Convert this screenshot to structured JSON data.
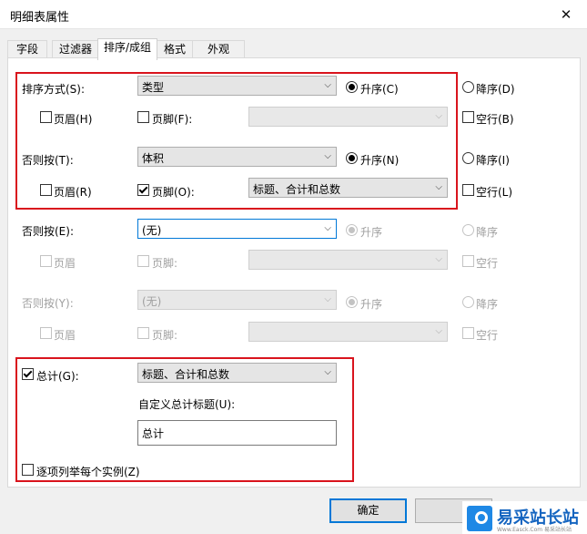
{
  "window": {
    "title": "明细表属性"
  },
  "tabs": [
    "字段",
    "过滤器",
    "排序/成组",
    "格式",
    "外观"
  ],
  "rows": [
    {
      "label": "排序方式(S):",
      "combo": "类型",
      "asc": "升序(C)",
      "desc": "降序(D)",
      "header": "页眉(H)",
      "footer": "页脚(F):",
      "footer_combo": "",
      "blank": "空行(B)"
    },
    {
      "label": "否则按(T):",
      "combo": "体积",
      "asc": "升序(N)",
      "desc": "降序(I)",
      "header": "页眉(R)",
      "footer": "页脚(O):",
      "footer_combo": "标题、合计和总数",
      "blank": "空行(L)"
    },
    {
      "label": "否则按(E):",
      "combo": "(无)",
      "asc": "升序",
      "desc": "降序",
      "header": "页眉",
      "footer": "页脚:",
      "footer_combo": "",
      "blank": "空行"
    },
    {
      "label": "否则按(Y):",
      "combo": "(无)",
      "asc": "升序",
      "desc": "降序",
      "header": "页眉",
      "footer": "页脚:",
      "footer_combo": "",
      "blank": "空行"
    }
  ],
  "totals": {
    "checkbox_label": "总计(G):",
    "combo": "标题、合计和总数",
    "custom_label": "自定义总计标题(U):",
    "custom_value": "总计",
    "itemize_label": "逐项列举每个实例(Z)"
  },
  "buttons": {
    "ok": "确定"
  },
  "watermark": {
    "text": "易采站长站",
    "sub": "Www.Easck.Com 易采站长站"
  }
}
